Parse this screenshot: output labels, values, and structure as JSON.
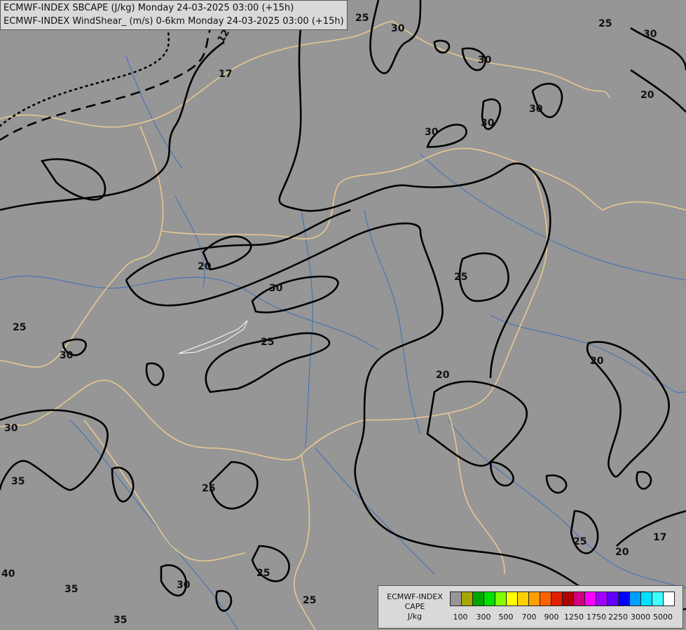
{
  "header": {
    "line1": "ECMWF-INDEX SBCAPE (J/kg) Monday 24-03-2025 03:00 (+15h)",
    "line2": "ECMWF-INDEX WindShear_ (m/s) 0-6km Monday 24-03-2025 03:00 (+15h)"
  },
  "legend": {
    "title_line1": "ECMWF-INDEX",
    "title_line2": "CAPE",
    "unit": "J/kg",
    "colors": [
      "#969696",
      "#a6a600",
      "#00a600",
      "#00e000",
      "#80ff00",
      "#ffff00",
      "#ffd000",
      "#ffa000",
      "#ff6000",
      "#e02000",
      "#b00000",
      "#d00080",
      "#ff00ff",
      "#a000ff",
      "#6000ff",
      "#0000ff",
      "#00a0ff",
      "#00e0ff",
      "#40ffff",
      "#ffffff"
    ],
    "ticks": [
      "100",
      "300",
      "500",
      "700",
      "900",
      "1250",
      "1750",
      "2250",
      "3000",
      "5000"
    ]
  },
  "contour_labels": [
    "12",
    "17",
    "20",
    "25",
    "30",
    "35",
    "40"
  ]
}
